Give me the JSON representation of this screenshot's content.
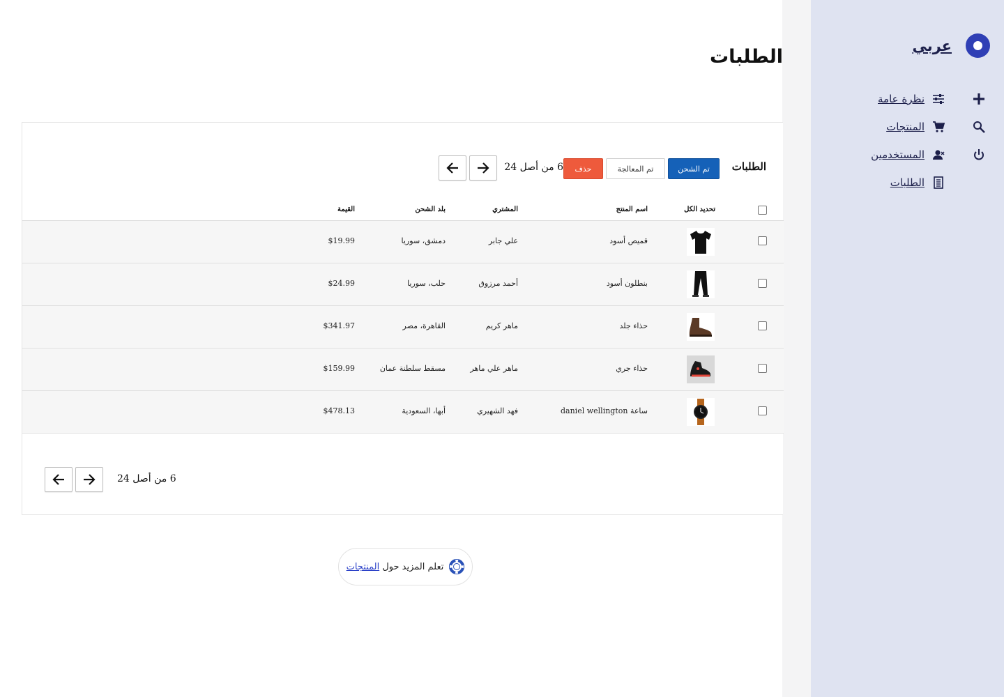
{
  "sidebar": {
    "brand": "عربي",
    "nav": [
      {
        "label": "نظرة عامة",
        "icon": "sliders-icon"
      },
      {
        "label": "المنتجات",
        "icon": "cart-icon"
      },
      {
        "label": "المستخدمين",
        "icon": "users-icon"
      },
      {
        "label": "الطلبات",
        "icon": "document-icon"
      }
    ],
    "tools": [
      {
        "icon": "plus-icon"
      },
      {
        "icon": "search-icon"
      },
      {
        "icon": "power-icon"
      }
    ]
  },
  "page": {
    "title": "الطلبات"
  },
  "orders": {
    "title": "الطلبات",
    "actions": {
      "shipped": "تم الشحن",
      "processed": "تم المعالجة",
      "delete": "حذف"
    },
    "pager": {
      "text": "6 من أصل 24"
    },
    "columns": {
      "select_all": "تحديد الكل",
      "product": "اسم المنتج",
      "buyer": "المشتري",
      "country": "بلد الشحن",
      "value": "القيمة"
    },
    "rows": [
      {
        "product": "قميص أسود",
        "buyer": "علي جابر",
        "country": "دمشق، سوريا",
        "value": "$19.99",
        "thumb": "shirt"
      },
      {
        "product": "بنطلون أسود",
        "buyer": "أحمد مرزوق",
        "country": "حلب، سوريا",
        "value": "$24.99",
        "thumb": "pants"
      },
      {
        "product": "حذاء جلد",
        "buyer": "ماهر كريم",
        "country": "القاهرة، مصر",
        "value": "$341.97",
        "thumb": "boot"
      },
      {
        "product": "حذاء جري",
        "buyer": "ماهر علي ماهر",
        "country": "مسقط سلطنة عمان",
        "value": "$159.99",
        "thumb": "sneaker"
      },
      {
        "product": "ساعة daniel wellington",
        "buyer": "فهد الشهيري",
        "country": "أبها، السعودية",
        "value": "$478.13",
        "thumb": "watch"
      }
    ]
  },
  "learn": {
    "text": "تعلم المزيد حول ",
    "link": "المنتجات",
    "icon": "lifebuoy-icon"
  },
  "colors": {
    "accent": "#2f3fb5",
    "primary_button": "#1561b8",
    "danger_button": "#ee5a3c",
    "sidebar_bg": "#dfe3f1"
  }
}
